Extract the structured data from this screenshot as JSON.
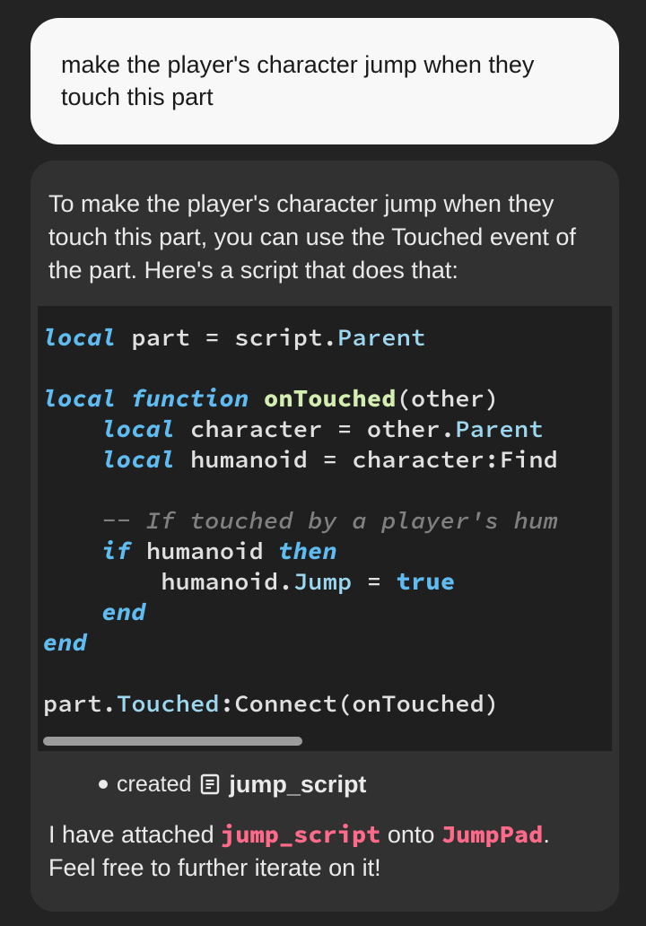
{
  "user": {
    "message": "make the player's character jump when they touch this part"
  },
  "assistant": {
    "intro": "To make the player's character jump when they touch this part, you can use the Touched event of the part. Here's a script that does that:",
    "code": {
      "l1": {
        "kw1": "local",
        "a": " part ",
        "eq": "=",
        "b": " script.",
        "prop": "Parent"
      },
      "l2": "",
      "l3": {
        "kw1": "local",
        "sp1": " ",
        "kw2": "function",
        "sp2": " ",
        "fn": "onTouched",
        "args": "(other)"
      },
      "l4": {
        "indent": "    ",
        "kw1": "local",
        "a": " character ",
        "eq": "=",
        "b": " other.",
        "prop": "Parent"
      },
      "l5": {
        "indent": "    ",
        "kw1": "local",
        "a": " humanoid ",
        "eq": "=",
        "b": " character:Find"
      },
      "l6": "",
      "l7": {
        "indent": "    ",
        "comment": "-- If touched by a player's hum"
      },
      "l8": {
        "indent": "    ",
        "kw1": "if",
        "a": " humanoid ",
        "kw2": "then"
      },
      "l9": {
        "indent": "        ",
        "a": "humanoid.",
        "prop": "Jump",
        "b": " ",
        "eq": "=",
        "c": " ",
        "bool": "true"
      },
      "l10": {
        "indent": "    ",
        "kw1": "end"
      },
      "l11": {
        "kw1": "end"
      },
      "l12": "",
      "l13": {
        "a": "part.",
        "prop": "Touched",
        "b": ":Connect(onTouched)"
      }
    },
    "created": {
      "prefix": "created",
      "script_name": "jump_script"
    },
    "followup": {
      "p1": "I have attached ",
      "s1": "jump_script",
      "p2": " onto ",
      "s2": "JumpPad",
      "p3": ". Feel free to further iterate on it!"
    }
  }
}
